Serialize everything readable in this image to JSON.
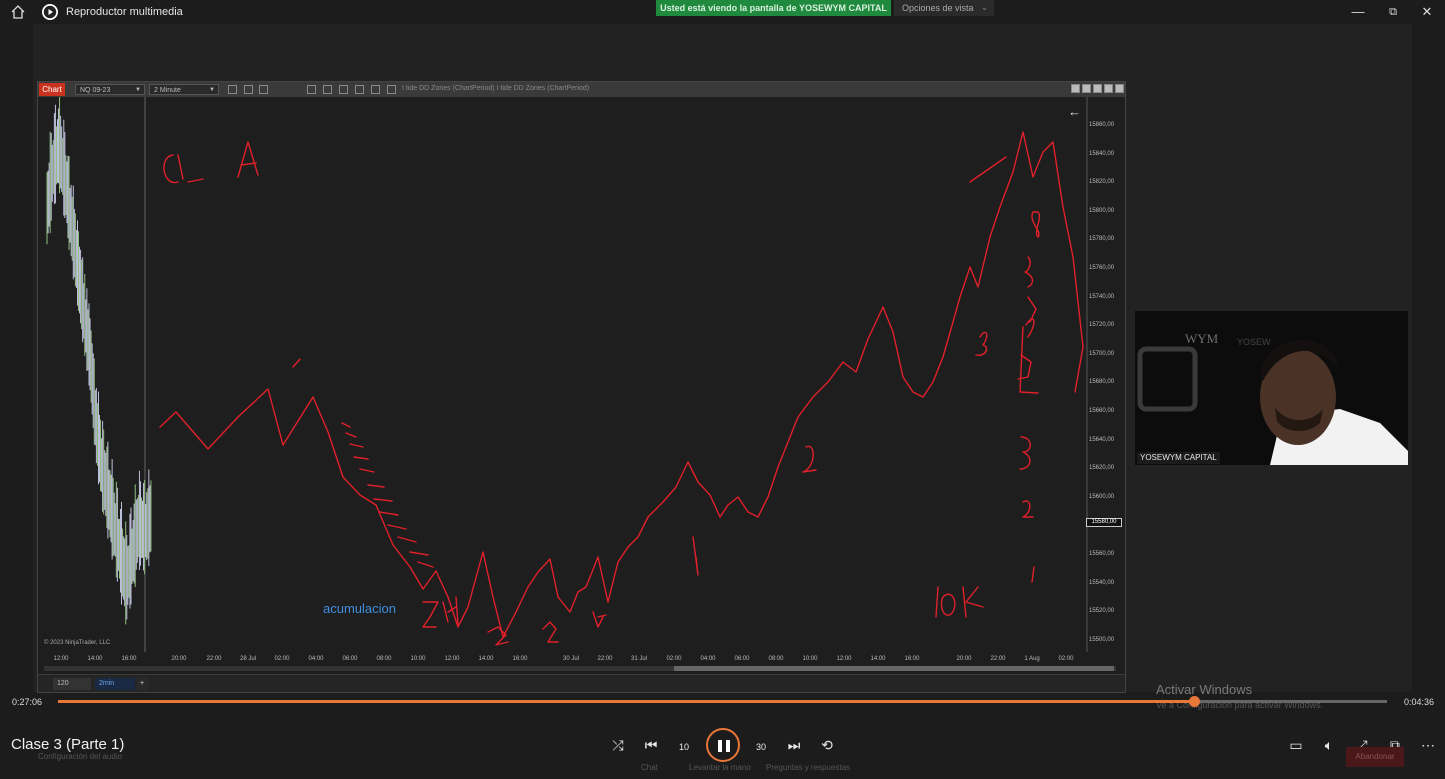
{
  "titlebar": {
    "app_title": "Reproductor multimedia",
    "share_banner": "Usted está viendo la pantalla de YOSEWYM CAPITAL",
    "view_options": "Opciones de vista",
    "icons": [
      "home-icon",
      "media-player-icon",
      "minimize-icon",
      "restore-icon",
      "close-icon"
    ]
  },
  "chart_window": {
    "tab": "Chart",
    "instrument": "NQ 09-23",
    "timeframe": "2 Minute",
    "indicator_text": "I tide DD Zones (ChartPeriod)   I tide DD Zones (ChartPeriod)",
    "copyright": "© 2023 NinjaTrader, LLC",
    "annotation": "acumulacion",
    "bottom_bars": "120",
    "bottom_tab": "2min",
    "bottom_add": "+",
    "current_price": "15580,00"
  },
  "chart_data": {
    "type": "line",
    "price_ticks": [
      "15860,00",
      "15840,00",
      "15820,00",
      "15800,00",
      "15780,00",
      "15760,00",
      "15740,00",
      "15720,00",
      "15700,00",
      "15680,00",
      "15660,00",
      "15640,00",
      "15620,00",
      "15600,00",
      "15580,00",
      "15560,00",
      "15540,00",
      "15520,00",
      "15500,00"
    ],
    "time_ticks": [
      "12:00",
      "14:00",
      "16:00",
      "20:00",
      "22:00",
      "28 Jul",
      "02:00",
      "04:00",
      "06:00",
      "08:00",
      "10:00",
      "12:00",
      "14:00",
      "16:00",
      "30 Jul",
      "22:00",
      "31 Jul",
      "02:00",
      "04:00",
      "06:00",
      "08:00",
      "10:00",
      "12:00",
      "14:00",
      "16:00",
      "20:00",
      "22:00",
      "1 Aug",
      "02:00"
    ],
    "price_range": [
      15500,
      15860
    ],
    "candles_close_sample": [
      15800,
      15830,
      15845,
      15820,
      15790,
      15760,
      15730,
      15700,
      15650,
      15620,
      15600,
      15580,
      15560,
      15540,
      15560,
      15580,
      15575,
      15585
    ]
  },
  "webcam": {
    "name": "YOSEWYM CAPITAL"
  },
  "watermark": {
    "title": "Activar Windows",
    "subtitle": "Ve a Configuración para activar Windows."
  },
  "timeline": {
    "elapsed": "0:27:06",
    "remaining": "0:04:36",
    "progress": 0.855
  },
  "controls": {
    "media_title": "Clase 3 (Parte 1)",
    "audio_config": "Configuración del audio",
    "chat_label": "Chat",
    "raise_hand_label": "Levantar la mano",
    "qa_label": "Preguntas y respuestas",
    "leave_label": "Abandonar",
    "rewind_label": "10",
    "forward_label": "30"
  },
  "colors": {
    "accent": "#e8773a",
    "banner": "#1f8a3e",
    "annotation_red": "#e0202a",
    "annotation_blue": "#3f8ee0"
  }
}
